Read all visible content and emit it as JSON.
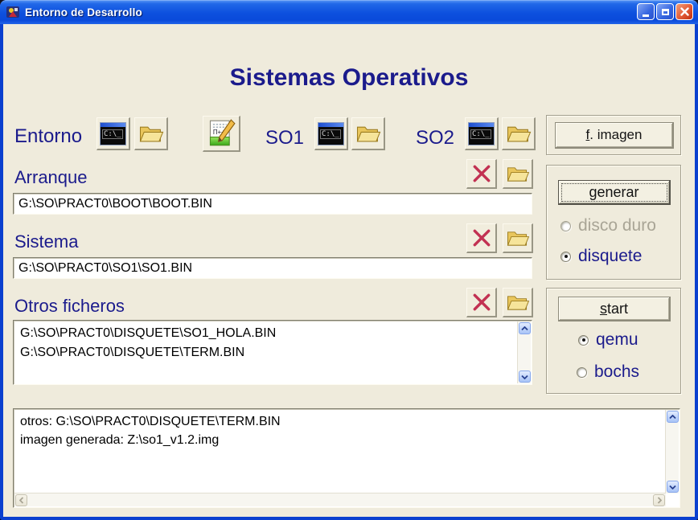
{
  "window": {
    "title": "Entorno de Desarrollo"
  },
  "header": {
    "title": "Sistemas Operativos"
  },
  "toolbar": {
    "entorno_label": "Entorno",
    "so1_label": "SO1",
    "so2_label": "SO2",
    "terminal_text": "C:\\_",
    "editor_glyph": "Π++"
  },
  "panels": {
    "f_imagen_accel": "f",
    "f_imagen_rest": ". imagen",
    "generar_accel": "g",
    "generar_rest": "enerar",
    "start_accel": "s",
    "start_rest": "tart",
    "disco_duro": {
      "label": "disco duro",
      "enabled": false,
      "selected": false
    },
    "disquete": {
      "label": "disquete",
      "enabled": true,
      "selected": true
    },
    "qemu": {
      "label": "qemu",
      "selected": true
    },
    "bochs": {
      "label": "bochs",
      "selected": false
    }
  },
  "fields": {
    "arranque": {
      "label": "Arranque",
      "value": "G:\\SO\\PRACT0\\BOOT\\BOOT.BIN"
    },
    "sistema": {
      "label": "Sistema",
      "value": "G:\\SO\\PRACT0\\SO1\\SO1.BIN"
    },
    "otros": {
      "label": "Otros ficheros",
      "lines": [
        "G:\\SO\\PRACT0\\DISQUETE\\SO1_HOLA.BIN",
        "G:\\SO\\PRACT0\\DISQUETE\\TERM.BIN"
      ]
    }
  },
  "log": {
    "lines": [
      "otros: G:\\SO\\PRACT0\\DISQUETE\\TERM.BIN",
      "imagen generada: Z:\\so1_v1.2.img"
    ]
  },
  "colors": {
    "accent_navy": "#1b1b8c",
    "background": "#efebdc",
    "titlebar_blue": "#0d50de",
    "close_red": "#d84a28",
    "x_icon_red": "#c23152",
    "folder_yellow": "#f4dc82",
    "disabled_text": "#a9a596"
  }
}
